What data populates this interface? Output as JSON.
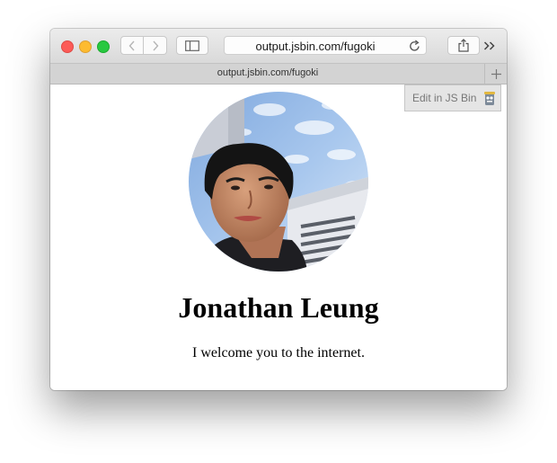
{
  "browser": {
    "address_url": "output.jsbin.com/fugoki",
    "tab_title": "output.jsbin.com/fugoki"
  },
  "icons": {
    "back": "chevron-left-icon",
    "forward": "chevron-right-icon",
    "sidebar": "sidebar-icon",
    "reload": "reload-icon",
    "share": "share-icon",
    "more": "double-chevron-icon",
    "new_tab": "plus-icon",
    "jsbin": "jsbin-logo-icon"
  },
  "page": {
    "edit_label": "Edit in JS Bin",
    "name": "Jonathan Leung",
    "tagline": "I welcome you to the internet."
  },
  "colors": {
    "close": "#fc5b57",
    "minimize": "#fdbb2f",
    "zoom": "#28c840"
  }
}
